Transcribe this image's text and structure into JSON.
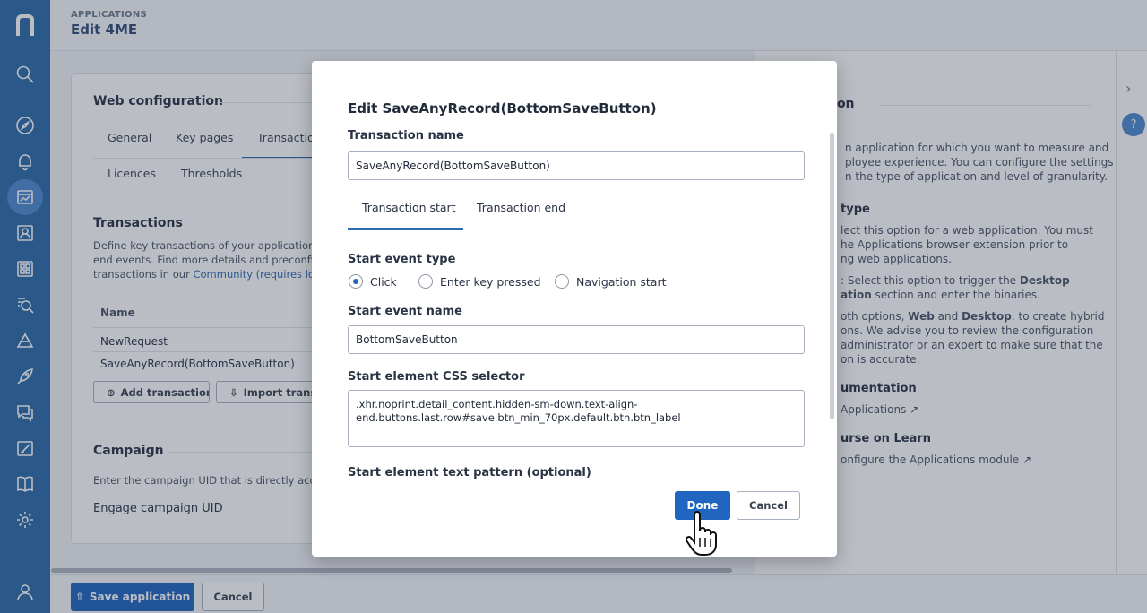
{
  "header": {
    "breadcrumb": "APPLICATIONS",
    "title": "Edit 4ME"
  },
  "web_config": {
    "title": "Web configuration",
    "tabs": [
      "General",
      "Key pages",
      "Transactions",
      "Licences",
      "Thresholds"
    ]
  },
  "transactions": {
    "title": "Transactions",
    "desc_line1": "Define key transactions of your application",
    "desc_line2": "end events. Find more details and preconfi",
    "desc_line3_prefix": "transactions in our ",
    "desc_link": "Community (requires log",
    "column_name": "Name",
    "rows": [
      "NewRequest",
      "SaveAnyRecord(BottomSaveButton)"
    ],
    "add_button": "Add transaction",
    "import_button": "Import transac"
  },
  "campaign": {
    "title": "Campaign",
    "desc": "Enter the campaign UID that is directly acce",
    "uid_label": "Engage campaign UID"
  },
  "help_panel": {
    "title": "ation",
    "para1": [
      "n application for which you want to measure and",
      "ployee experience. You can configure the settings",
      "n the type of application and level of granularity."
    ],
    "type_head": "type",
    "para2": [
      "lect this option for a web application. You must",
      "he Applications browser extension prior to",
      "ng web applications."
    ],
    "para3_a": ": Select this option to trigger the ",
    "para3_b": "Desktop",
    "para3_c": "ation",
    "para3_d": " section and enter the binaries.",
    "para4_a": "oth options, ",
    "para4_b": "Web",
    "para4_c": " and ",
    "para4_d": "Desktop",
    "para4_e": ", to create hybrid",
    "para4_lines": [
      "ons. We advise you to review the configuration",
      "administrator or an expert to make sure that the",
      "on is accurate."
    ],
    "doc_head": "umentation",
    "doc_link": "Applications",
    "course_head": "urse on Learn",
    "course_link": "onfigure the Applications module"
  },
  "footer": {
    "save": "Save application",
    "cancel": "Cancel"
  },
  "modal": {
    "title": "Edit SaveAnyRecord(BottomSaveButton)",
    "name_label": "Transaction name",
    "name_value": "SaveAnyRecord(BottomSaveButton)",
    "tabs": [
      "Transaction start",
      "Transaction end"
    ],
    "start_type_label": "Start event type",
    "start_types": [
      "Click",
      "Enter key pressed",
      "Navigation start"
    ],
    "selected_type": "Click",
    "event_name_label": "Start event name",
    "event_name_value": "BottomSaveButton",
    "css_label": "Start element CSS selector",
    "css_line1": ".xhr.noprint.detail_content.hidden-sm-down.text-align-",
    "css_line2": "end.buttons.last.row#save.btn_min_70px.default.btn.btn_label",
    "text_pattern_label": "Start element text pattern (optional)",
    "done": "Done",
    "cancel": "Cancel"
  },
  "colors": {
    "sidebar": "#2b6aa8",
    "primary": "#2065c0",
    "link": "#2b6bb0"
  }
}
